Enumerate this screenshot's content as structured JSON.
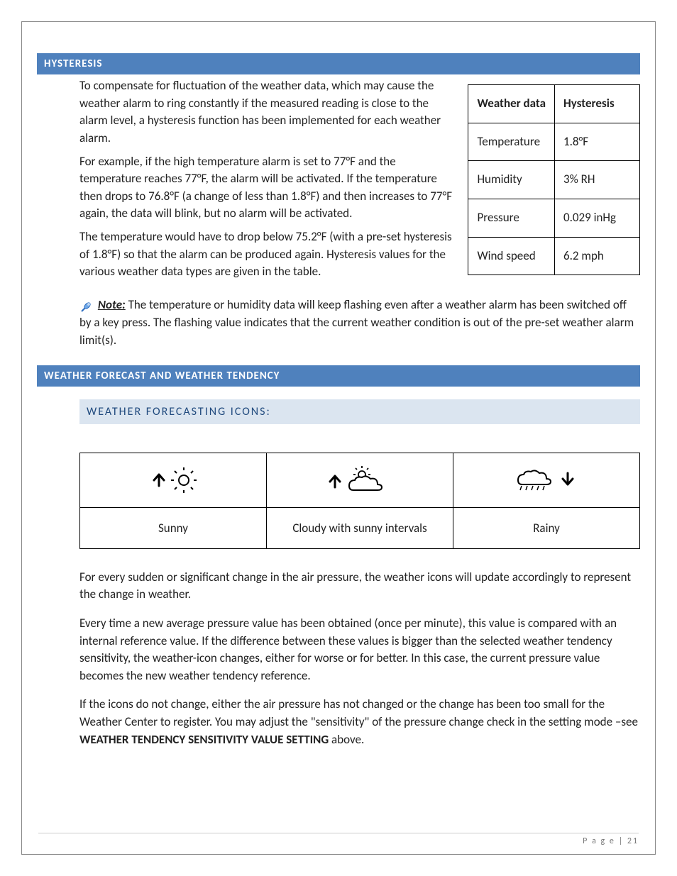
{
  "sections": {
    "hysteresis": {
      "title": "HYSTERESIS",
      "p1": "To compensate for fluctuation of the weather data, which may cause the weather alarm to ring constantly if the measured reading is close to the alarm level, a hysteresis function has been implemented for each weather alarm.",
      "p2": "For example, if the high temperature alarm is set to 77°F and the temperature reaches 77°F, the alarm will be activated. If the temperature then drops to 76.8°F (a change of less than 1.8°F) and then increases to 77°F again, the data will blink, but no alarm will be activated.",
      "p3": "The temperature would have to drop below 75.2°F (with a pre-set hysteresis of 1.8°F) so that the alarm can be produced again. Hysteresis values for the various weather data types are given in the table.",
      "note_label": "Note:",
      "note_text": " The temperature or humidity data will keep flashing even after a weather alarm has been switched off by a key press. The flashing value indicates that the current weather condition is out of the pre-set weather alarm limit(s)."
    },
    "forecast": {
      "title": "WEATHER FORECAST AND WEATHER TENDENCY",
      "sub": "WEATHER FORECASTING ICONS:",
      "icons": {
        "sunny": "Sunny",
        "cloudy": "Cloudy with sunny intervals",
        "rainy": "Rainy"
      },
      "p1": "For every sudden or significant change in the air pressure, the weather icons will update accordingly to represent the change in weather.",
      "p2": "Every time a new average pressure value has been obtained (once per minute), this value is compared with an internal reference value. If the difference between these values is bigger than the selected weather tendency sensitivity, the weather-icon changes, either for worse or for better. In this case, the current pressure value becomes the new weather tendency reference.",
      "p3a": "If the icons do not change, either the air pressure has not changed or the change has been too small for the Weather Center to register. You may adjust the \"sensitivity\" of the pressure change check in the setting mode –see ",
      "p3b": "WEATHER TENDENCY SENSITIVITY VALUE SETTING",
      "p3c": " above."
    }
  },
  "hysteresis_table": {
    "header": {
      "c1": "Weather data",
      "c2": "Hysteresis"
    },
    "rows": [
      {
        "c1": "Temperature",
        "c2": "1.8°F"
      },
      {
        "c1": "Humidity",
        "c2": "3% RH"
      },
      {
        "c1": "Pressure",
        "c2": "0.029 inHg"
      },
      {
        "c1": "Wind speed",
        "c2": "6.2 mph"
      }
    ]
  },
  "footer": {
    "label": "P a g e",
    "sep": " | ",
    "num": "21"
  }
}
